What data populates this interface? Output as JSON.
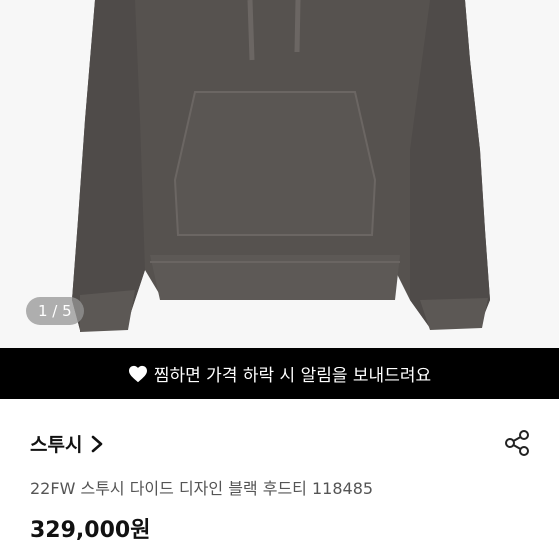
{
  "image": {
    "counter": "1 / 5"
  },
  "banner": {
    "text": "찜하면 가격 하락 시 알림을 보내드려요",
    "icon": "heart-icon"
  },
  "store": {
    "name": "스투시",
    "icon": "chevron-right-icon"
  },
  "product": {
    "title": "22FW 스투시 다이드 디자인 블랙 후드티 118485",
    "price": "329,000원"
  },
  "actions": {
    "share_icon": "share-icon"
  },
  "colors": {
    "banner_bg": "#000000",
    "hoodie": "#56524f"
  }
}
